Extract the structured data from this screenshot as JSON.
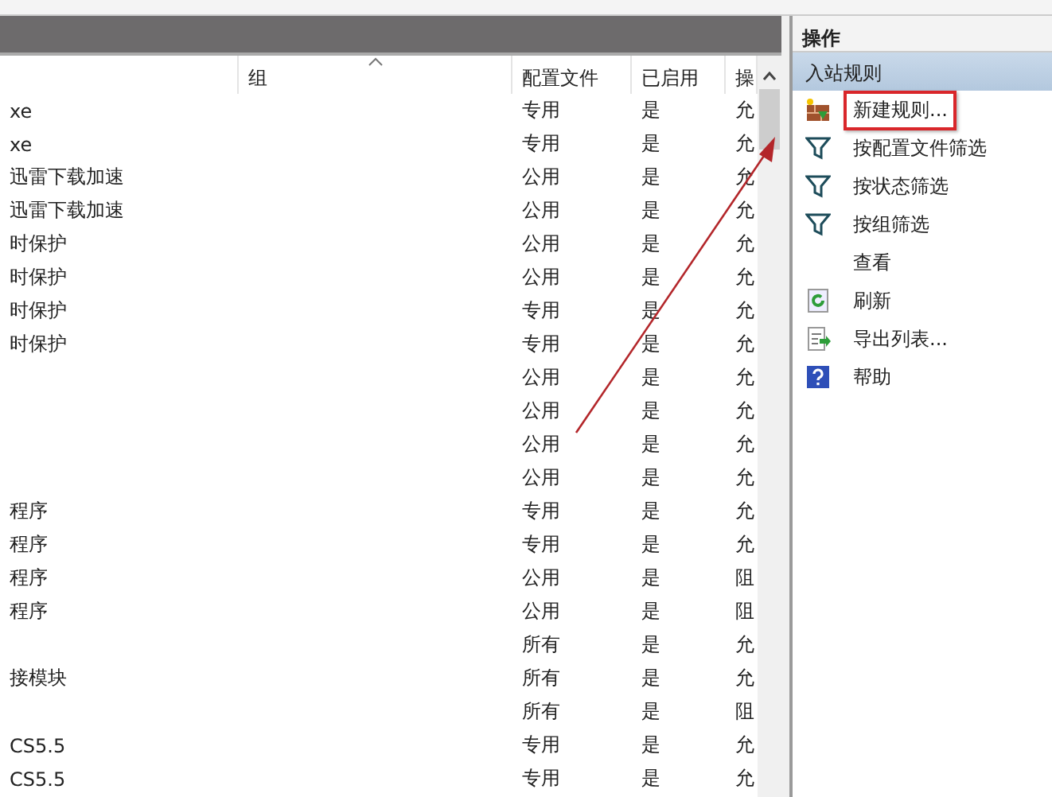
{
  "rules_table": {
    "columns": [
      {
        "label": "组",
        "sorted": true
      },
      {
        "label": "配置文件",
        "sorted": false
      },
      {
        "label": "已启用",
        "sorted": false
      },
      {
        "label": "操",
        "sorted": false
      }
    ],
    "rows": [
      {
        "name": "xe",
        "profile": "专用",
        "enabled": "是",
        "action": "允"
      },
      {
        "name": "xe",
        "profile": "专用",
        "enabled": "是",
        "action": "允"
      },
      {
        "name": "迅雷下载加速",
        "profile": "公用",
        "enabled": "是",
        "action": "允"
      },
      {
        "name": "迅雷下载加速",
        "profile": "公用",
        "enabled": "是",
        "action": "允"
      },
      {
        "name": "时保护",
        "profile": "公用",
        "enabled": "是",
        "action": "允"
      },
      {
        "name": "时保护",
        "profile": "公用",
        "enabled": "是",
        "action": "允"
      },
      {
        "name": "时保护",
        "profile": "专用",
        "enabled": "是",
        "action": "允"
      },
      {
        "name": "时保护",
        "profile": "专用",
        "enabled": "是",
        "action": "允"
      },
      {
        "profile": "公用",
        "enabled": "是",
        "action": "允"
      },
      {
        "profile": "公用",
        "enabled": "是",
        "action": "允"
      },
      {
        "profile": "公用",
        "enabled": "是",
        "action": "允"
      },
      {
        "profile": "公用",
        "enabled": "是",
        "action": "允"
      },
      {
        "name": "程序",
        "profile": "专用",
        "enabled": "是",
        "action": "允"
      },
      {
        "name": "程序",
        "profile": "专用",
        "enabled": "是",
        "action": "允"
      },
      {
        "name": "程序",
        "profile": "公用",
        "enabled": "是",
        "action": "阻"
      },
      {
        "name": "程序",
        "profile": "公用",
        "enabled": "是",
        "action": "阻"
      },
      {
        "profile": "所有",
        "enabled": "是",
        "action": "允"
      },
      {
        "name": "接模块",
        "profile": "所有",
        "enabled": "是",
        "action": "允"
      },
      {
        "profile": "所有",
        "enabled": "是",
        "action": "阻"
      },
      {
        "name": "CS5.5",
        "profile": "专用",
        "enabled": "是",
        "action": "允"
      },
      {
        "name": "CS5.5",
        "profile": "专用",
        "enabled": "是",
        "action": "允"
      }
    ]
  },
  "actions_pane": {
    "title": "操作",
    "section": "入站规则",
    "items": [
      {
        "label": "新建规则...",
        "kind": "new",
        "highlighted": true
      },
      {
        "label": "按配置文件筛选",
        "kind": "filter",
        "highlighted": false
      },
      {
        "label": "按状态筛选",
        "kind": "filter",
        "highlighted": false
      },
      {
        "label": "按组筛选",
        "kind": "filter",
        "highlighted": false
      },
      {
        "label": "查看",
        "kind": "view",
        "highlighted": false
      },
      {
        "label": "刷新",
        "kind": "refresh",
        "highlighted": false
      },
      {
        "label": "导出列表...",
        "kind": "export",
        "highlighted": false
      },
      {
        "label": "帮助",
        "kind": "help",
        "highlighted": false
      }
    ]
  },
  "annotation": {
    "arrow": true
  }
}
